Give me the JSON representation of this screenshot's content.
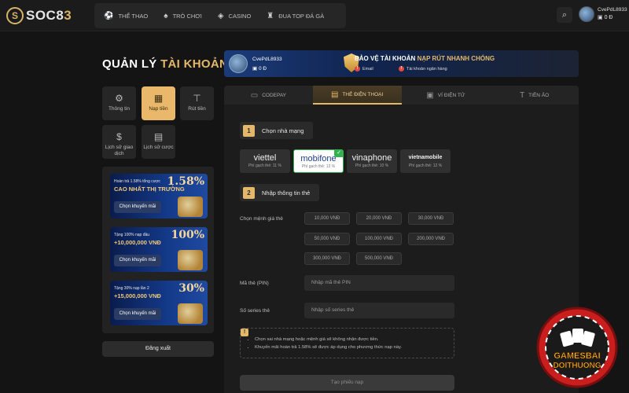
{
  "brand": {
    "logo_text": "SOC8",
    "logo_accent": "3",
    "accent": "#e4b86a"
  },
  "nav": [
    {
      "label": "THỂ THAO",
      "icon": "soccer-ball-icon",
      "glyph": "⚽"
    },
    {
      "label": "TRÒ CHƠI",
      "icon": "slot-machine-icon",
      "glyph": "♠"
    },
    {
      "label": "CASINO",
      "icon": "casino-chips-icon",
      "glyph": "◈"
    },
    {
      "label": "ĐUA TOP ĐÁ GÀ",
      "icon": "rooster-icon",
      "glyph": "♜"
    }
  ],
  "user": {
    "name": "CvePdL8933",
    "balance": "0 Đ"
  },
  "page_title": {
    "prefix": "QUẢN LÝ ",
    "highlight": "TÀI KHOẢN"
  },
  "account_menu": [
    {
      "label": "Thông tin",
      "icon": "user-settings-icon",
      "glyph": "⚙"
    },
    {
      "label": "Nạp tiền",
      "icon": "deposit-icon",
      "glyph": "▦"
    },
    {
      "label": "Rút tiền",
      "icon": "withdraw-icon",
      "glyph": "⊤"
    },
    {
      "label": "Lịch sử giao dịch",
      "icon": "transaction-history-icon",
      "glyph": "$"
    },
    {
      "label": "Lịch sử cược",
      "icon": "bet-history-icon",
      "glyph": "▤"
    }
  ],
  "promos": [
    {
      "line1": "Hoàn trả 1.58% tổng cược",
      "line2": "CAO NHẤT THỊ TRƯỜNG",
      "big": "1.58%",
      "button": "Chọn khuyến mãi"
    },
    {
      "line1": "Tặng 100% nạp đầu",
      "line2": "+10,000,000 VNĐ",
      "big": "100%",
      "button": "Chọn khuyến mãi"
    },
    {
      "line1": "Tặng 30% nạp lần 2",
      "line2": "+15,000,000 VNĐ",
      "big": "30%",
      "button": "Chọn khuyến mãi"
    }
  ],
  "logout_label": "Đăng xuất",
  "security": {
    "title_prefix": "BẢO VỆ TÀI KHOẢN ",
    "title_highlight": "NẠP RÚT NHANH CHÓNG",
    "warn_email": "Email",
    "warn_bank": "Tài khoản ngân hàng"
  },
  "tabs": [
    {
      "label": "CODEPAY",
      "icon": "codepay-icon",
      "glyph": "▭",
      "active": false
    },
    {
      "label": "THẺ ĐIỆN THOẠI",
      "icon": "phone-card-icon",
      "glyph": "▤",
      "active": true
    },
    {
      "label": "VÍ ĐIỆN TỬ",
      "icon": "e-wallet-icon",
      "glyph": "▣",
      "active": false
    },
    {
      "label": "TIỀN ẢO",
      "icon": "crypto-icon",
      "glyph": "T",
      "active": false
    }
  ],
  "step1": {
    "num": "1",
    "label": "Chọn nhà mạng"
  },
  "step2": {
    "num": "2",
    "label": "Nhập thông tin thẻ"
  },
  "carriers": [
    {
      "name": "viettel",
      "fee": "Phí gạch thẻ: 11 %",
      "selected": false
    },
    {
      "name": "mobifone",
      "fee": "Phí gạch thẻ: 13 %",
      "selected": true
    },
    {
      "name": "vinaphone",
      "fee": "Phí gạch thẻ: 10 %",
      "selected": false
    },
    {
      "name": "vietnamobile",
      "fee": "Phí gạch thẻ: 12 %",
      "selected": false
    }
  ],
  "denomination_label": "Chọn mệnh giá thẻ",
  "denominations": [
    "10,000 VNĐ",
    "20,000 VNĐ",
    "30,000 VNĐ",
    "50,000 VNĐ",
    "100,000 VNĐ",
    "200,000 VNĐ",
    "300,000 VNĐ",
    "500,000 VNĐ"
  ],
  "pin": {
    "label": "Mã thẻ (PIN)",
    "placeholder": "Nhập mã thẻ PIN"
  },
  "serial": {
    "label": "Số series thẻ",
    "placeholder": "Nhập số series thẻ"
  },
  "notes": [
    "Chọn sai nhà mạng hoặc mệnh giá sẽ không nhận được tiền.",
    "Khuyến mãi hoàn trả 1.58% sẽ được áp dụng cho phương thức nạp này."
  ],
  "submit_label": "Tạo phiếu nạp",
  "watermark": {
    "line1": "GAMESBAI",
    "line2": "DOITHUONG"
  }
}
